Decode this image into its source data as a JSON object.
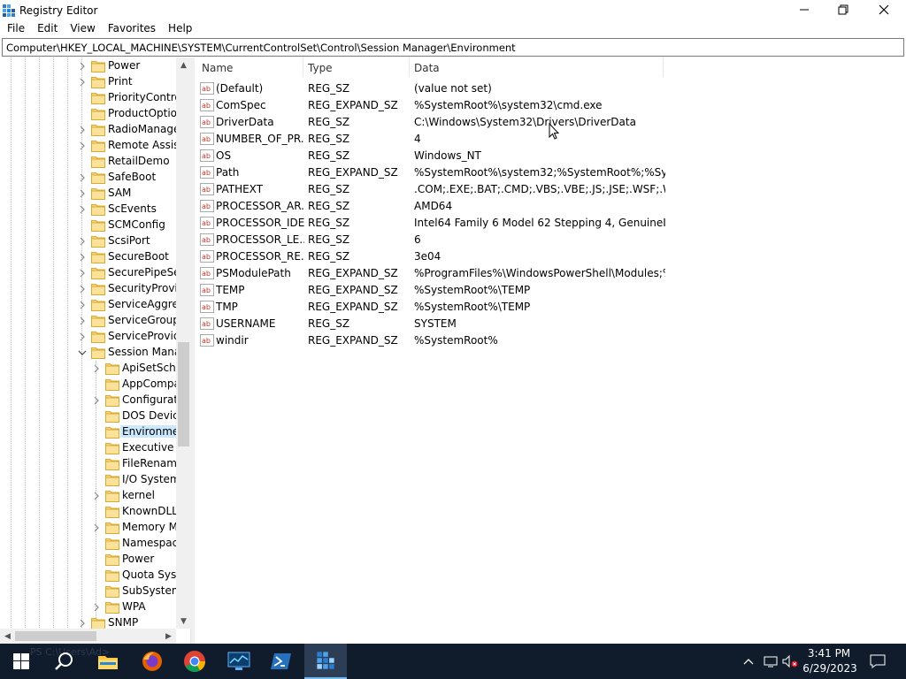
{
  "window": {
    "title": "Registry Editor",
    "icon": "regedit-icon",
    "controls": [
      "minimize-icon",
      "maximize-icon",
      "close-icon"
    ]
  },
  "menu": [
    "File",
    "Edit",
    "View",
    "Favorites",
    "Help"
  ],
  "address": "Computer\\HKEY_LOCAL_MACHINE\\SYSTEM\\CurrentControlSet\\Control\\Session Manager\\Environment",
  "tree": {
    "level1": [
      {
        "label": "Power",
        "expander": "collapsed"
      },
      {
        "label": "Print",
        "expander": "collapsed"
      },
      {
        "label": "PriorityControl",
        "expander": "none"
      },
      {
        "label": "ProductOptions",
        "expander": "none"
      },
      {
        "label": "RadioManagement",
        "expander": "collapsed"
      },
      {
        "label": "Remote Assistance",
        "expander": "collapsed"
      },
      {
        "label": "RetailDemo",
        "expander": "none"
      },
      {
        "label": "SafeBoot",
        "expander": "collapsed"
      },
      {
        "label": "SAM",
        "expander": "collapsed"
      },
      {
        "label": "ScEvents",
        "expander": "collapsed"
      },
      {
        "label": "SCMConfig",
        "expander": "none"
      },
      {
        "label": "ScsiPort",
        "expander": "collapsed"
      },
      {
        "label": "SecureBoot",
        "expander": "collapsed"
      },
      {
        "label": "SecurePipeServers",
        "expander": "collapsed"
      },
      {
        "label": "SecurityProviders",
        "expander": "collapsed"
      },
      {
        "label": "ServiceAggregatedEvents",
        "expander": "collapsed"
      },
      {
        "label": "ServiceGroupOrder",
        "expander": "collapsed"
      },
      {
        "label": "ServiceProvider",
        "expander": "collapsed"
      },
      {
        "label": "Session Manager",
        "expander": "expanded"
      }
    ],
    "level2": [
      {
        "label": "ApiSetSchemaExtensions",
        "expander": "collapsed"
      },
      {
        "label": "AppCompatCache",
        "expander": "none"
      },
      {
        "label": "Configuration Manager",
        "expander": "collapsed"
      },
      {
        "label": "DOS Devices",
        "expander": "none"
      },
      {
        "label": "Environment",
        "expander": "none",
        "selected": true
      },
      {
        "label": "Executive",
        "expander": "none"
      },
      {
        "label": "FileRenameOperations",
        "expander": "none"
      },
      {
        "label": "I/O System",
        "expander": "none"
      },
      {
        "label": "kernel",
        "expander": "collapsed"
      },
      {
        "label": "KnownDLLs",
        "expander": "none"
      },
      {
        "label": "Memory Management",
        "expander": "collapsed"
      },
      {
        "label": "Namespace Separation",
        "expander": "none"
      },
      {
        "label": "Power",
        "expander": "none"
      },
      {
        "label": "Quota System",
        "expander": "none"
      },
      {
        "label": "SubSystems",
        "expander": "none"
      },
      {
        "label": "WPA",
        "expander": "collapsed"
      }
    ],
    "after": {
      "label": "SNMP",
      "expander": "collapsed"
    }
  },
  "list": {
    "columns": [
      "Name",
      "Type",
      "Data"
    ],
    "rows": [
      {
        "name": "(Default)",
        "type": "REG_SZ",
        "data": "(value not set)"
      },
      {
        "name": "ComSpec",
        "type": "REG_EXPAND_SZ",
        "data": "%SystemRoot%\\system32\\cmd.exe"
      },
      {
        "name": "DriverData",
        "type": "REG_SZ",
        "data": "C:\\Windows\\System32\\Drivers\\DriverData"
      },
      {
        "name": "NUMBER_OF_PR...",
        "type": "REG_SZ",
        "data": "4"
      },
      {
        "name": "OS",
        "type": "REG_SZ",
        "data": "Windows_NT"
      },
      {
        "name": "Path",
        "type": "REG_EXPAND_SZ",
        "data": "%SystemRoot%\\system32;%SystemRoot%;%Syste..."
      },
      {
        "name": "PATHEXT",
        "type": "REG_SZ",
        "data": ".COM;.EXE;.BAT;.CMD;.VBS;.VBE;.JS;.JSE;.WSF;.WSH..."
      },
      {
        "name": "PROCESSOR_AR...",
        "type": "REG_SZ",
        "data": "AMD64"
      },
      {
        "name": "PROCESSOR_IDE...",
        "type": "REG_SZ",
        "data": "Intel64 Family 6 Model 62 Stepping 4, GenuineIntel"
      },
      {
        "name": "PROCESSOR_LE...",
        "type": "REG_SZ",
        "data": "6"
      },
      {
        "name": "PROCESSOR_RE...",
        "type": "REG_SZ",
        "data": "3e04"
      },
      {
        "name": "PSModulePath",
        "type": "REG_EXPAND_SZ",
        "data": "%ProgramFiles%\\WindowsPowerShell\\Modules;%..."
      },
      {
        "name": "TEMP",
        "type": "REG_EXPAND_SZ",
        "data": "%SystemRoot%\\TEMP"
      },
      {
        "name": "TMP",
        "type": "REG_EXPAND_SZ",
        "data": "%SystemRoot%\\TEMP"
      },
      {
        "name": "USERNAME",
        "type": "REG_SZ",
        "data": "SYSTEM"
      },
      {
        "name": "windir",
        "type": "REG_EXPAND_SZ",
        "data": "%SystemRoot%"
      }
    ]
  },
  "taskbar": {
    "ps_hint": "PS C:\\Users\\Ad>",
    "apps": [
      "start-icon",
      "search-icon",
      "file-explorer-icon",
      "firefox-icon",
      "chrome-icon",
      "monitor-app-icon",
      "powershell-icon",
      "regedit-icon"
    ],
    "tray": [
      "chevron-up-icon",
      "network-icon",
      "volume-muted-icon",
      "notification-icon"
    ],
    "time": "3:41 PM",
    "date": "6/29/2023"
  },
  "colors": {
    "selection": "#cce8ff",
    "folder": "#f8d775",
    "taskbar": "#101c2c",
    "active_app": "#2c3e55"
  }
}
